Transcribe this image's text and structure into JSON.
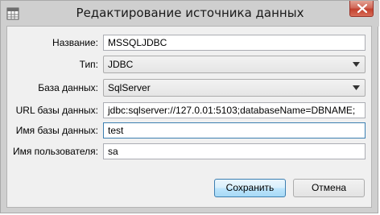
{
  "window": {
    "title": "Редактирование источника данных"
  },
  "form": {
    "name": {
      "label": "Название:",
      "value": "MSSQLJDBC"
    },
    "type": {
      "label": "Тип:",
      "value": "JDBC"
    },
    "database": {
      "label": "База данных:",
      "value": "SqlServer"
    },
    "url": {
      "label": "URL базы данных:",
      "value": "jdbc:sqlserver://127.0.01:5103;databaseName=DBNAME;"
    },
    "db_name": {
      "label": "Имя базы данных:",
      "value": "test"
    },
    "user": {
      "label": "Имя пользователя:",
      "value": "sa"
    }
  },
  "buttons": {
    "save": "Сохранить",
    "cancel": "Отмена"
  },
  "colors": {
    "close_button": "#c2402d",
    "focus_border": "#3c7fb1",
    "titlebar": "#cfcfcf"
  }
}
